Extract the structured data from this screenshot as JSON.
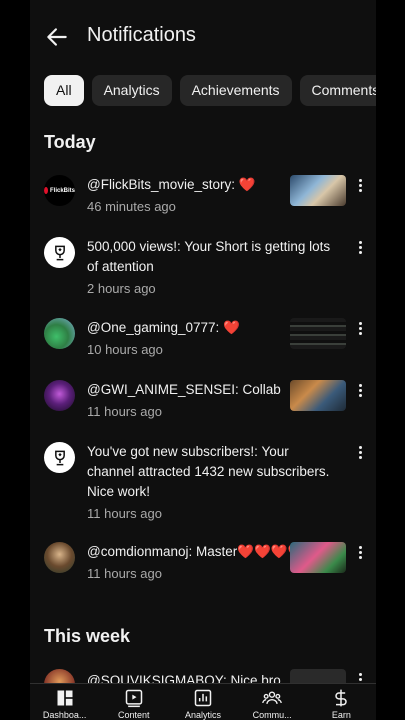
{
  "header": {
    "title": "Notifications"
  },
  "chips": [
    "All",
    "Analytics",
    "Achievements",
    "Comments"
  ],
  "sections": {
    "today": "Today",
    "this_week": "This week"
  },
  "notifications": [
    {
      "who": "@FlickBits_movie_story:",
      "msg": "",
      "hearts": "❤️",
      "time": "46 minutes ago",
      "avatar_label": "FlickBits"
    },
    {
      "who": "500,000 views!:",
      "msg": " Your Short is getting lots of attention",
      "hearts": "",
      "time": "2 hours ago"
    },
    {
      "who": "@One_gaming_0777:",
      "msg": "",
      "hearts": "❤️",
      "time": "10 hours ago"
    },
    {
      "who": "@GWI_ANIME_SENSEI:",
      "msg": " Collab",
      "hearts": "",
      "time": "11 hours ago"
    },
    {
      "who": "You've got new subscribers!:",
      "msg": " Your channel attracted 1432 new subscribers. Nice work!",
      "hearts": "",
      "time": "11 hours ago"
    },
    {
      "who": "@comdionmanoj:",
      "msg": " Master",
      "hearts": "❤️❤️❤️❤️❤️",
      "time": "11 hours ago"
    },
    {
      "who": "@SOUVIKSIGMABOY:",
      "msg": " Nice bro",
      "hearts": "",
      "time": ""
    }
  ],
  "bottom_nav": [
    "Dashboa...",
    "Content",
    "Analytics",
    "Commu...",
    "Earn"
  ],
  "colors": {
    "background": "#0f0f0f",
    "chip": "#272727",
    "heart": "#e0112b",
    "secondary_text": "#aaaaaa"
  }
}
